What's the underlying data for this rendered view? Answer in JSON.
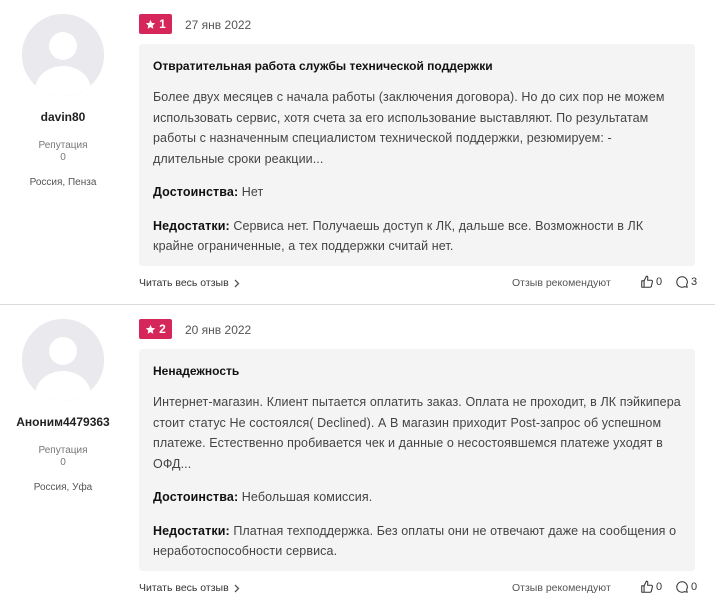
{
  "reviews": [
    {
      "number": "1",
      "date": "27 янв 2022",
      "author": "davin80",
      "reputation_label": "Репутация",
      "reputation_value": "0",
      "location": "Россия, Пенза",
      "title": "Отвратительная работа службы технической поддержки",
      "body": "Более двух месяцев с начала работы (заключения договора). Но до сих пор не можем использовать сервис, хотя счета за его использование выставляют. По результатам работы с назначенным специалистом технической поддержки, резюмируем: - длительные сроки реакции...",
      "pros_label": "Достоинства:",
      "pros": "Нет",
      "cons_label": "Недостатки:",
      "cons": "Сервиса нет. Получаешь доступ к ЛК, дальше все. Возможности в ЛК крайне ограниченные, а тех поддержки считай нет.",
      "read_more": "Читать весь отзыв",
      "recommend": "Отзыв рекомендуют",
      "likes": "0",
      "comments": "3"
    },
    {
      "number": "2",
      "date": "20 янв 2022",
      "author": "Аноним4479363",
      "reputation_label": "Репутация",
      "reputation_value": "0",
      "location": "Россия, Уфа",
      "title": "Ненадежность",
      "body": "Интернет-магазин. Клиент пытается оплатить заказ. Оплата не проходит, в ЛК пэйкипера стоит статус Не состоялся( Declined). А В магазин приходит Post-запрос об успешном платеже. Естественно пробивается чек и данные о несостоявшемся платеже уходят в ОФД...",
      "pros_label": "Достоинства:",
      "pros": "Небольшая комиссия.",
      "cons_label": "Недостатки:",
      "cons": "Платная техподдержка. Без оплаты они не отвечают даже на сообщения о неработоспособности сервиса.",
      "read_more": "Читать весь отзыв",
      "recommend": "Отзыв рекомендуют",
      "likes": "0",
      "comments": "0"
    }
  ],
  "colors": {
    "badge": "#d6275b",
    "card_bg": "#f4f4f5",
    "avatar_bg": "#e9e9ee"
  },
  "icons": [
    "star-icon",
    "chevron-right-icon",
    "thumbs-up-icon",
    "comment-icon",
    "user-silhouette-icon"
  ]
}
